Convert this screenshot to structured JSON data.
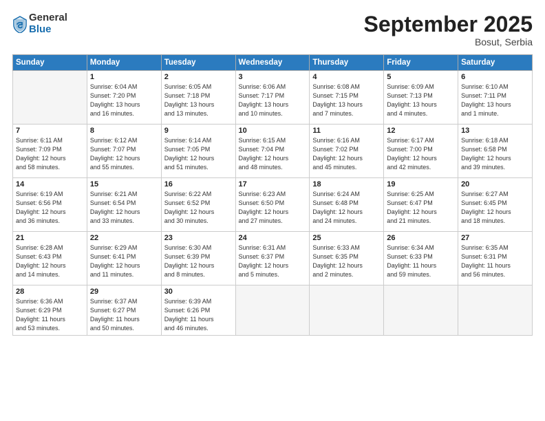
{
  "logo": {
    "general": "General",
    "blue": "Blue"
  },
  "title": "September 2025",
  "subtitle": "Bosut, Serbia",
  "days_header": [
    "Sunday",
    "Monday",
    "Tuesday",
    "Wednesday",
    "Thursday",
    "Friday",
    "Saturday"
  ],
  "weeks": [
    [
      {
        "num": "",
        "info": ""
      },
      {
        "num": "1",
        "info": "Sunrise: 6:04 AM\nSunset: 7:20 PM\nDaylight: 13 hours\nand 16 minutes."
      },
      {
        "num": "2",
        "info": "Sunrise: 6:05 AM\nSunset: 7:18 PM\nDaylight: 13 hours\nand 13 minutes."
      },
      {
        "num": "3",
        "info": "Sunrise: 6:06 AM\nSunset: 7:17 PM\nDaylight: 13 hours\nand 10 minutes."
      },
      {
        "num": "4",
        "info": "Sunrise: 6:08 AM\nSunset: 7:15 PM\nDaylight: 13 hours\nand 7 minutes."
      },
      {
        "num": "5",
        "info": "Sunrise: 6:09 AM\nSunset: 7:13 PM\nDaylight: 13 hours\nand 4 minutes."
      },
      {
        "num": "6",
        "info": "Sunrise: 6:10 AM\nSunset: 7:11 PM\nDaylight: 13 hours\nand 1 minute."
      }
    ],
    [
      {
        "num": "7",
        "info": "Sunrise: 6:11 AM\nSunset: 7:09 PM\nDaylight: 12 hours\nand 58 minutes."
      },
      {
        "num": "8",
        "info": "Sunrise: 6:12 AM\nSunset: 7:07 PM\nDaylight: 12 hours\nand 55 minutes."
      },
      {
        "num": "9",
        "info": "Sunrise: 6:14 AM\nSunset: 7:05 PM\nDaylight: 12 hours\nand 51 minutes."
      },
      {
        "num": "10",
        "info": "Sunrise: 6:15 AM\nSunset: 7:04 PM\nDaylight: 12 hours\nand 48 minutes."
      },
      {
        "num": "11",
        "info": "Sunrise: 6:16 AM\nSunset: 7:02 PM\nDaylight: 12 hours\nand 45 minutes."
      },
      {
        "num": "12",
        "info": "Sunrise: 6:17 AM\nSunset: 7:00 PM\nDaylight: 12 hours\nand 42 minutes."
      },
      {
        "num": "13",
        "info": "Sunrise: 6:18 AM\nSunset: 6:58 PM\nDaylight: 12 hours\nand 39 minutes."
      }
    ],
    [
      {
        "num": "14",
        "info": "Sunrise: 6:19 AM\nSunset: 6:56 PM\nDaylight: 12 hours\nand 36 minutes."
      },
      {
        "num": "15",
        "info": "Sunrise: 6:21 AM\nSunset: 6:54 PM\nDaylight: 12 hours\nand 33 minutes."
      },
      {
        "num": "16",
        "info": "Sunrise: 6:22 AM\nSunset: 6:52 PM\nDaylight: 12 hours\nand 30 minutes."
      },
      {
        "num": "17",
        "info": "Sunrise: 6:23 AM\nSunset: 6:50 PM\nDaylight: 12 hours\nand 27 minutes."
      },
      {
        "num": "18",
        "info": "Sunrise: 6:24 AM\nSunset: 6:48 PM\nDaylight: 12 hours\nand 24 minutes."
      },
      {
        "num": "19",
        "info": "Sunrise: 6:25 AM\nSunset: 6:47 PM\nDaylight: 12 hours\nand 21 minutes."
      },
      {
        "num": "20",
        "info": "Sunrise: 6:27 AM\nSunset: 6:45 PM\nDaylight: 12 hours\nand 18 minutes."
      }
    ],
    [
      {
        "num": "21",
        "info": "Sunrise: 6:28 AM\nSunset: 6:43 PM\nDaylight: 12 hours\nand 14 minutes."
      },
      {
        "num": "22",
        "info": "Sunrise: 6:29 AM\nSunset: 6:41 PM\nDaylight: 12 hours\nand 11 minutes."
      },
      {
        "num": "23",
        "info": "Sunrise: 6:30 AM\nSunset: 6:39 PM\nDaylight: 12 hours\nand 8 minutes."
      },
      {
        "num": "24",
        "info": "Sunrise: 6:31 AM\nSunset: 6:37 PM\nDaylight: 12 hours\nand 5 minutes."
      },
      {
        "num": "25",
        "info": "Sunrise: 6:33 AM\nSunset: 6:35 PM\nDaylight: 12 hours\nand 2 minutes."
      },
      {
        "num": "26",
        "info": "Sunrise: 6:34 AM\nSunset: 6:33 PM\nDaylight: 11 hours\nand 59 minutes."
      },
      {
        "num": "27",
        "info": "Sunrise: 6:35 AM\nSunset: 6:31 PM\nDaylight: 11 hours\nand 56 minutes."
      }
    ],
    [
      {
        "num": "28",
        "info": "Sunrise: 6:36 AM\nSunset: 6:29 PM\nDaylight: 11 hours\nand 53 minutes."
      },
      {
        "num": "29",
        "info": "Sunrise: 6:37 AM\nSunset: 6:27 PM\nDaylight: 11 hours\nand 50 minutes."
      },
      {
        "num": "30",
        "info": "Sunrise: 6:39 AM\nSunset: 6:26 PM\nDaylight: 11 hours\nand 46 minutes."
      },
      {
        "num": "",
        "info": ""
      },
      {
        "num": "",
        "info": ""
      },
      {
        "num": "",
        "info": ""
      },
      {
        "num": "",
        "info": ""
      }
    ]
  ]
}
